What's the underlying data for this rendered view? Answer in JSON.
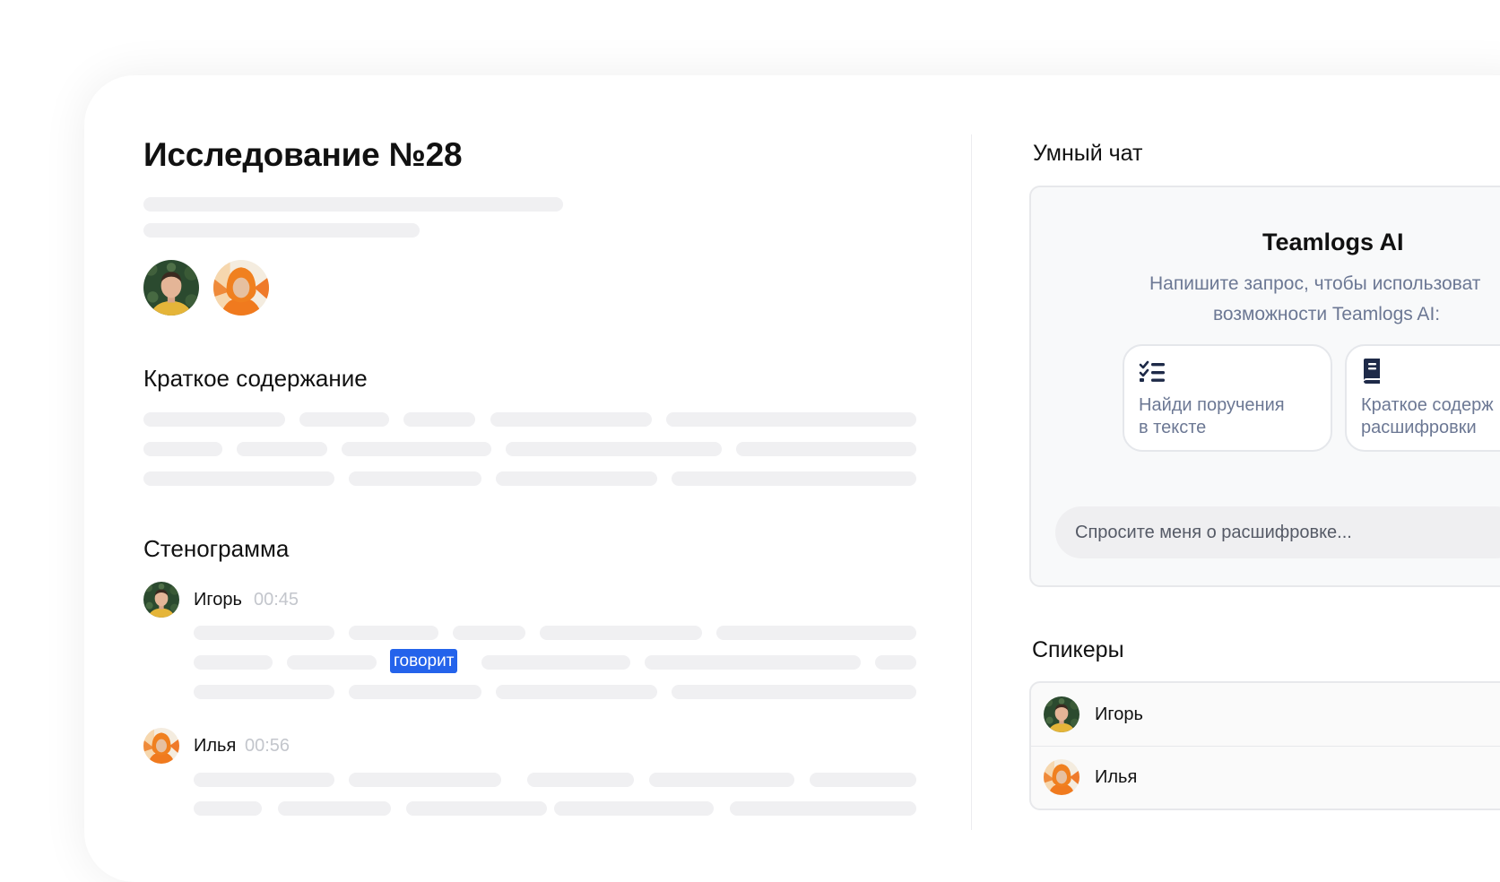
{
  "study": {
    "title": "Исследование №28",
    "participants": [
      {
        "avatar": "avatar-igor"
      },
      {
        "avatar": "avatar-ilya"
      }
    ]
  },
  "summary": {
    "heading": "Краткое содержание"
  },
  "transcript": {
    "heading": "Стенограмма",
    "entries": [
      {
        "speaker": "Игорь",
        "time": "00:45",
        "highlight": "говорит"
      },
      {
        "speaker": "Илья",
        "time": "00:56"
      }
    ]
  },
  "smart_chat": {
    "heading": "Умный чат",
    "ai_title": "Teamlogs AI",
    "subtitle_line1": "Напишите запрос, чтобы использоват",
    "subtitle_line2": "возможности Teamlogs AI:",
    "suggestions": [
      {
        "icon": "checklist-icon",
        "line1": "Найди поручения",
        "line2": "в тексте"
      },
      {
        "icon": "book-icon",
        "line1": "Краткое содерж",
        "line2": "расшифровки"
      }
    ],
    "input_placeholder": "Спросите меня о расшифровке..."
  },
  "speakers": {
    "heading": "Спикеры",
    "items": [
      {
        "name": "Игорь"
      },
      {
        "name": "Илья"
      }
    ]
  },
  "colors": {
    "accent": "#2463eb",
    "muted_text": "#6c7894",
    "skeleton": "#f0f0f2",
    "icon_navy": "#1e2a48"
  }
}
